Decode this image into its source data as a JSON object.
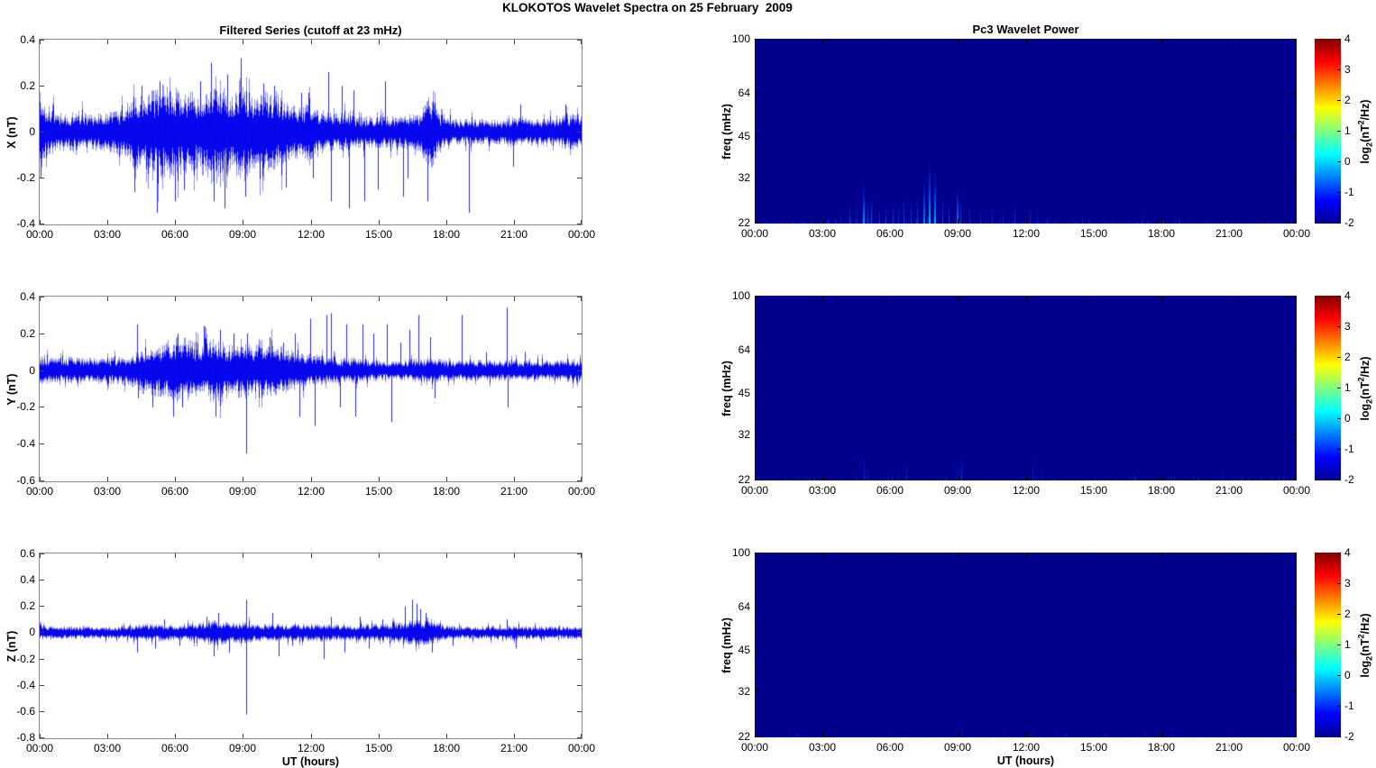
{
  "figure": {
    "title": "KLOKOTOS Wavelet Spectra on 25 February  2009"
  },
  "left_column_title": "Filtered Series (cutoff at 23 mHz)",
  "right_column_title": "Pc3 Wavelet Power",
  "time_axis": {
    "label": "UT (hours)",
    "ticks": [
      "00:00",
      "03:00",
      "06:00",
      "09:00",
      "12:00",
      "15:00",
      "18:00",
      "21:00",
      "00:00"
    ],
    "hours": [
      0,
      3,
      6,
      9,
      12,
      15,
      18,
      21,
      24
    ]
  },
  "colors": {
    "series_line": "#0000EE",
    "spectrogram_bg": "#00008C",
    "streak_mid": "#0050FF",
    "streak_bright": "#00E0FF",
    "axis_line": "#8a8a8a",
    "tick": "#000000"
  },
  "colorbar": {
    "ticks": [
      "4",
      "3",
      "2",
      "1",
      "0",
      "-1",
      "-2"
    ],
    "label_parts": {
      "prefix": "log",
      "sub": "2",
      "mid": "(nT",
      "sup": "2",
      "suffix": "/Hz)"
    },
    "gradient_colors": [
      "#00008F",
      "#0000FF",
      "#00FFFF",
      "#FFFF00",
      "#FF0000",
      "#7F0000"
    ],
    "gradient_positions": [
      0,
      0.125,
      0.375,
      0.625,
      0.875,
      1
    ]
  },
  "chart_data": [
    {
      "id": "x-series",
      "type": "line",
      "ylabel": "X (nT)",
      "ylim": [
        -0.4,
        0.4
      ],
      "yticks": [
        "0.4",
        "0.2",
        "0",
        "-0.2",
        "-0.4"
      ],
      "xlim_hours": [
        0,
        24
      ],
      "envelope": [
        [
          0,
          0.15
        ],
        [
          0.3,
          0.08
        ],
        [
          1,
          0.06
        ],
        [
          2,
          0.06
        ],
        [
          3,
          0.06
        ],
        [
          3.5,
          0.07
        ],
        [
          4,
          0.1
        ],
        [
          4.3,
          0.13
        ],
        [
          4.6,
          0.1
        ],
        [
          5,
          0.13
        ],
        [
          5.5,
          0.15
        ],
        [
          6,
          0.14
        ],
        [
          6.5,
          0.13
        ],
        [
          7,
          0.12
        ],
        [
          7.5,
          0.16
        ],
        [
          8,
          0.17
        ],
        [
          8.5,
          0.13
        ],
        [
          9,
          0.16
        ],
        [
          9.5,
          0.12
        ],
        [
          10,
          0.13
        ],
        [
          10.5,
          0.12
        ],
        [
          11,
          0.1
        ],
        [
          11.5,
          0.08
        ],
        [
          12,
          0.09
        ],
        [
          12.5,
          0.07
        ],
        [
          13,
          0.06
        ],
        [
          14,
          0.05
        ],
        [
          15,
          0.05
        ],
        [
          16,
          0.05
        ],
        [
          16.9,
          0.06
        ],
        [
          17.2,
          0.13
        ],
        [
          17.5,
          0.1
        ],
        [
          17.8,
          0.05
        ],
        [
          18.5,
          0.04
        ],
        [
          19.5,
          0.04
        ],
        [
          20.5,
          0.04
        ],
        [
          21,
          0.05
        ],
        [
          22,
          0.04
        ],
        [
          23,
          0.05
        ],
        [
          24,
          0.06
        ]
      ],
      "spikes": [
        [
          0.05,
          -0.2
        ],
        [
          4.2,
          -0.26
        ],
        [
          4.5,
          0.2
        ],
        [
          5.2,
          -0.35
        ],
        [
          5.3,
          0.22
        ],
        [
          6.0,
          -0.3
        ],
        [
          6.4,
          -0.25
        ],
        [
          7.1,
          0.22
        ],
        [
          7.6,
          0.3
        ],
        [
          7.7,
          -0.3
        ],
        [
          8.2,
          -0.33
        ],
        [
          8.3,
          0.25
        ],
        [
          8.9,
          0.32
        ],
        [
          9.1,
          -0.28
        ],
        [
          9.9,
          0.21
        ],
        [
          10.4,
          0.2
        ],
        [
          10.9,
          -0.24
        ],
        [
          11.6,
          0.17
        ],
        [
          11.9,
          0.17
        ],
        [
          12.1,
          -0.2
        ],
        [
          12.8,
          0.26
        ],
        [
          12.9,
          -0.3
        ],
        [
          13.4,
          0.2
        ],
        [
          13.7,
          -0.33
        ],
        [
          13.9,
          0.18
        ],
        [
          14.4,
          -0.3
        ],
        [
          15.0,
          -0.25
        ],
        [
          15.3,
          0.22
        ],
        [
          16.1,
          -0.28
        ],
        [
          16.3,
          -0.2
        ],
        [
          17.2,
          -0.3
        ],
        [
          19.05,
          -0.35
        ],
        [
          21.0,
          -0.15
        ],
        [
          21.3,
          0.12
        ],
        [
          23.3,
          0.12
        ]
      ]
    },
    {
      "id": "y-series",
      "type": "line",
      "ylabel": "Y (nT)",
      "ylim": [
        -0.6,
        0.4
      ],
      "yticks": [
        "0.4",
        "0.2",
        "0",
        "-0.2",
        "-0.4",
        "-0.6"
      ],
      "xlim_hours": [
        0,
        24
      ],
      "envelope": [
        [
          0,
          0.06
        ],
        [
          0.5,
          0.05
        ],
        [
          1,
          0.05
        ],
        [
          1.5,
          0.06
        ],
        [
          2,
          0.05
        ],
        [
          3,
          0.05
        ],
        [
          4,
          0.06
        ],
        [
          4.5,
          0.09
        ],
        [
          5,
          0.1
        ],
        [
          5.5,
          0.11
        ],
        [
          6,
          0.13
        ],
        [
          6.5,
          0.13
        ],
        [
          7,
          0.1
        ],
        [
          7.5,
          0.12
        ],
        [
          8,
          0.12
        ],
        [
          8.5,
          0.1
        ],
        [
          9,
          0.11
        ],
        [
          9.5,
          0.1
        ],
        [
          10,
          0.1
        ],
        [
          10.5,
          0.1
        ],
        [
          11,
          0.08
        ],
        [
          11.5,
          0.07
        ],
        [
          12,
          0.06
        ],
        [
          12.5,
          0.06
        ],
        [
          13,
          0.05
        ],
        [
          14,
          0.05
        ],
        [
          15,
          0.04
        ],
        [
          16,
          0.04
        ],
        [
          17,
          0.05
        ],
        [
          17.5,
          0.05
        ],
        [
          18,
          0.04
        ],
        [
          19,
          0.04
        ],
        [
          20,
          0.04
        ],
        [
          21,
          0.04
        ],
        [
          22,
          0.04
        ],
        [
          23,
          0.04
        ],
        [
          24,
          0.05
        ]
      ],
      "spikes": [
        [
          4.3,
          0.25
        ],
        [
          4.35,
          -0.15
        ],
        [
          5.0,
          -0.2
        ],
        [
          5.9,
          -0.25
        ],
        [
          6.1,
          0.2
        ],
        [
          6.3,
          -0.2
        ],
        [
          7.3,
          0.24
        ],
        [
          7.8,
          -0.25
        ],
        [
          8.0,
          0.22
        ],
        [
          8.6,
          0.2
        ],
        [
          9.15,
          -0.45
        ],
        [
          9.2,
          0.2
        ],
        [
          10.2,
          0.18
        ],
        [
          10.8,
          0.15
        ],
        [
          11.3,
          0.2
        ],
        [
          11.5,
          -0.25
        ],
        [
          12.0,
          0.28
        ],
        [
          12.2,
          -0.3
        ],
        [
          12.7,
          0.3
        ],
        [
          12.9,
          0.31
        ],
        [
          13.3,
          -0.2
        ],
        [
          13.6,
          0.25
        ],
        [
          14.0,
          -0.25
        ],
        [
          14.3,
          0.25
        ],
        [
          14.8,
          0.2
        ],
        [
          15.4,
          0.25
        ],
        [
          15.6,
          -0.28
        ],
        [
          16.0,
          0.15
        ],
        [
          16.4,
          0.22
        ],
        [
          16.8,
          0.3
        ],
        [
          17.3,
          0.18
        ],
        [
          17.5,
          -0.15
        ],
        [
          18.7,
          0.3
        ],
        [
          19.8,
          0.1
        ],
        [
          20.7,
          0.34
        ],
        [
          20.75,
          -0.2
        ],
        [
          21.5,
          0.1
        ]
      ]
    },
    {
      "id": "z-series",
      "type": "line",
      "ylabel": "Z (nT)",
      "ylim": [
        -0.8,
        0.6
      ],
      "yticks": [
        "0.6",
        "0.4",
        "0.2",
        "0",
        "-0.2",
        "-0.4",
        "-0.6",
        "-0.8"
      ],
      "xlim_hours": [
        0,
        24
      ],
      "envelope": [
        [
          0,
          0.04
        ],
        [
          2,
          0.035
        ],
        [
          4,
          0.035
        ],
        [
          4.5,
          0.05
        ],
        [
          5,
          0.05
        ],
        [
          6,
          0.045
        ],
        [
          7,
          0.05
        ],
        [
          7.5,
          0.07
        ],
        [
          8,
          0.07
        ],
        [
          8.5,
          0.05
        ],
        [
          9,
          0.06
        ],
        [
          9.5,
          0.05
        ],
        [
          10,
          0.05
        ],
        [
          11,
          0.045
        ],
        [
          12,
          0.05
        ],
        [
          12.5,
          0.05
        ],
        [
          13,
          0.045
        ],
        [
          14,
          0.04
        ],
        [
          14.5,
          0.05
        ],
        [
          15,
          0.05
        ],
        [
          16,
          0.06
        ],
        [
          16.5,
          0.07
        ],
        [
          17,
          0.07
        ],
        [
          17.5,
          0.06
        ],
        [
          18,
          0.04
        ],
        [
          19,
          0.035
        ],
        [
          20,
          0.035
        ],
        [
          21,
          0.04
        ],
        [
          22,
          0.035
        ],
        [
          23,
          0.035
        ],
        [
          24,
          0.04
        ]
      ],
      "spikes": [
        [
          4.3,
          -0.15
        ],
        [
          5.1,
          -0.12
        ],
        [
          5.5,
          0.1
        ],
        [
          6.2,
          -0.1
        ],
        [
          7.4,
          0.12
        ],
        [
          7.7,
          -0.18
        ],
        [
          7.9,
          0.15
        ],
        [
          8.4,
          -0.15
        ],
        [
          9.15,
          -0.62
        ],
        [
          9.17,
          0.25
        ],
        [
          10.3,
          0.15
        ],
        [
          10.6,
          -0.18
        ],
        [
          11.2,
          -0.1
        ],
        [
          12.6,
          -0.2
        ],
        [
          12.9,
          0.12
        ],
        [
          13.5,
          -0.15
        ],
        [
          14.2,
          0.12
        ],
        [
          14.6,
          -0.12
        ],
        [
          15.2,
          0.1
        ],
        [
          16.2,
          0.2
        ],
        [
          16.5,
          0.25
        ],
        [
          16.7,
          0.22
        ],
        [
          16.9,
          0.18
        ],
        [
          17.1,
          0.15
        ],
        [
          17.4,
          -0.15
        ],
        [
          18.3,
          -0.1
        ],
        [
          20.7,
          0.1
        ],
        [
          21.1,
          -0.12
        ]
      ]
    },
    {
      "id": "x-wavelet",
      "type": "heatmap",
      "ylabel": "freq (mHz)",
      "yticks": [
        "100",
        "64",
        "45",
        "32",
        "22"
      ],
      "ytick_fracs_from_top": [
        0,
        0.2947,
        0.5274,
        0.7525,
        1
      ],
      "xlim_hours": [
        0,
        24
      ],
      "value_range": [
        -2,
        4
      ],
      "background_value": -2,
      "floor_noise": 0.5,
      "streaks": [
        [
          3.0,
          0.07,
          0.3
        ],
        [
          3.3,
          0.06,
          0.25
        ],
        [
          3.8,
          0.08,
          0.3
        ],
        [
          4.2,
          0.15,
          0.45
        ],
        [
          4.5,
          0.13,
          0.4
        ],
        [
          4.85,
          0.25,
          0.8
        ],
        [
          5.0,
          0.16,
          0.5
        ],
        [
          5.15,
          0.2,
          0.6
        ],
        [
          5.5,
          0.12,
          0.4
        ],
        [
          5.8,
          0.13,
          0.4
        ],
        [
          6.1,
          0.16,
          0.45
        ],
        [
          6.35,
          0.12,
          0.35
        ],
        [
          6.6,
          0.18,
          0.5
        ],
        [
          6.9,
          0.16,
          0.45
        ],
        [
          7.2,
          0.2,
          0.5
        ],
        [
          7.5,
          0.28,
          0.7
        ],
        [
          7.75,
          0.4,
          0.9
        ],
        [
          8.0,
          0.33,
          0.85
        ],
        [
          8.3,
          0.18,
          0.5
        ],
        [
          8.6,
          0.16,
          0.45
        ],
        [
          9.0,
          0.24,
          0.7
        ],
        [
          9.1,
          0.18,
          0.5
        ],
        [
          9.5,
          0.13,
          0.4
        ],
        [
          10.0,
          0.1,
          0.3
        ],
        [
          10.5,
          0.13,
          0.35
        ],
        [
          11.0,
          0.1,
          0.3
        ],
        [
          11.5,
          0.15,
          0.4
        ],
        [
          12.2,
          0.13,
          0.35
        ],
        [
          12.5,
          0.1,
          0.3
        ],
        [
          13.0,
          0.08,
          0.25
        ],
        [
          14.5,
          0.08,
          0.25
        ],
        [
          15.5,
          0.05,
          0.2
        ],
        [
          17.2,
          0.08,
          0.3
        ],
        [
          21.0,
          0.05,
          0.15
        ]
      ]
    },
    {
      "id": "y-wavelet",
      "type": "heatmap",
      "ylabel": "freq (mHz)",
      "yticks": [
        "100",
        "64",
        "45",
        "32",
        "22"
      ],
      "ytick_fracs_from_top": [
        0,
        0.2947,
        0.5274,
        0.7525,
        1
      ],
      "xlim_hours": [
        0,
        24
      ],
      "value_range": [
        -2,
        4
      ],
      "background_value": -2,
      "floor_noise": 0.25,
      "streaks": [
        [
          4.85,
          0.18,
          0.35
        ],
        [
          5.0,
          0.1,
          0.25
        ],
        [
          5.9,
          0.08,
          0.2
        ],
        [
          6.3,
          0.1,
          0.25
        ],
        [
          6.7,
          0.15,
          0.3
        ],
        [
          9.0,
          0.12,
          0.3
        ],
        [
          9.15,
          0.2,
          0.4
        ],
        [
          12.3,
          0.18,
          0.3
        ],
        [
          12.7,
          0.1,
          0.2
        ],
        [
          16.8,
          0.08,
          0.15
        ],
        [
          20.7,
          0.1,
          0.2
        ]
      ]
    },
    {
      "id": "z-wavelet",
      "type": "heatmap",
      "ylabel": "freq (mHz)",
      "yticks": [
        "100",
        "64",
        "45",
        "32",
        "22"
      ],
      "ytick_fracs_from_top": [
        0,
        0.2947,
        0.5274,
        0.7525,
        1
      ],
      "xlim_hours": [
        0,
        24
      ],
      "value_range": [
        -2,
        4
      ],
      "background_value": -2,
      "floor_noise": 0.1,
      "streaks": [
        [
          9.15,
          0.15,
          0.2
        ],
        [
          12.3,
          0.08,
          0.12
        ],
        [
          16.5,
          0.05,
          0.1
        ]
      ]
    }
  ]
}
